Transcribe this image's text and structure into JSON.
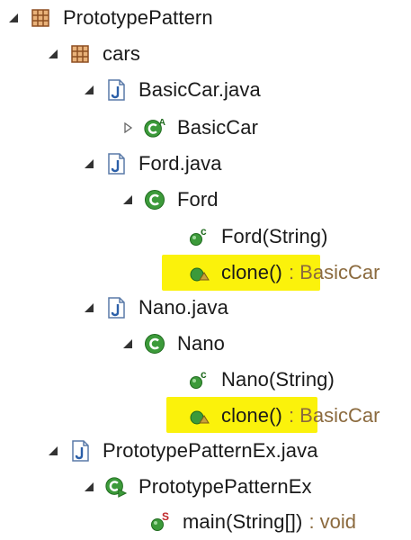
{
  "tree": {
    "project": {
      "label": "PrototypePattern",
      "icon": "package-icon"
    },
    "pkg": {
      "label": "cars",
      "icon": "package-icon"
    },
    "basiccar_file": {
      "label": "BasicCar.java",
      "icon": "java-file-icon"
    },
    "basiccar_class": {
      "label": "BasicCar",
      "icon": "abstract-class-icon"
    },
    "ford_file": {
      "label": "Ford.java",
      "icon": "java-file-icon"
    },
    "ford_class": {
      "label": "Ford",
      "icon": "class-icon"
    },
    "ford_ctor": {
      "label": "Ford(String)",
      "icon": "constructor-icon"
    },
    "ford_clone": {
      "label": "clone()",
      "type": ": BasicCar",
      "icon": "protected-method-icon",
      "highlighted": true
    },
    "nano_file": {
      "label": "Nano.java",
      "icon": "java-file-icon"
    },
    "nano_class": {
      "label": "Nano",
      "icon": "class-icon"
    },
    "nano_ctor": {
      "label": "Nano(String)",
      "icon": "constructor-icon"
    },
    "nano_clone": {
      "label": "clone()",
      "type": ": BasicCar",
      "icon": "protected-method-icon",
      "highlighted": true
    },
    "ex_file": {
      "label": "PrototypePatternEx.java",
      "icon": "java-file-icon"
    },
    "ex_class": {
      "label": "PrototypePatternEx",
      "icon": "runnable-class-icon"
    },
    "ex_main": {
      "label": "main(String[])",
      "type": ": void",
      "icon": "static-method-icon"
    }
  },
  "colors": {
    "highlight": "#fbf20b",
    "class_green": "#3c9a3a",
    "package_brown": "#9b5a2a",
    "type_text": "#8b6a3e"
  }
}
